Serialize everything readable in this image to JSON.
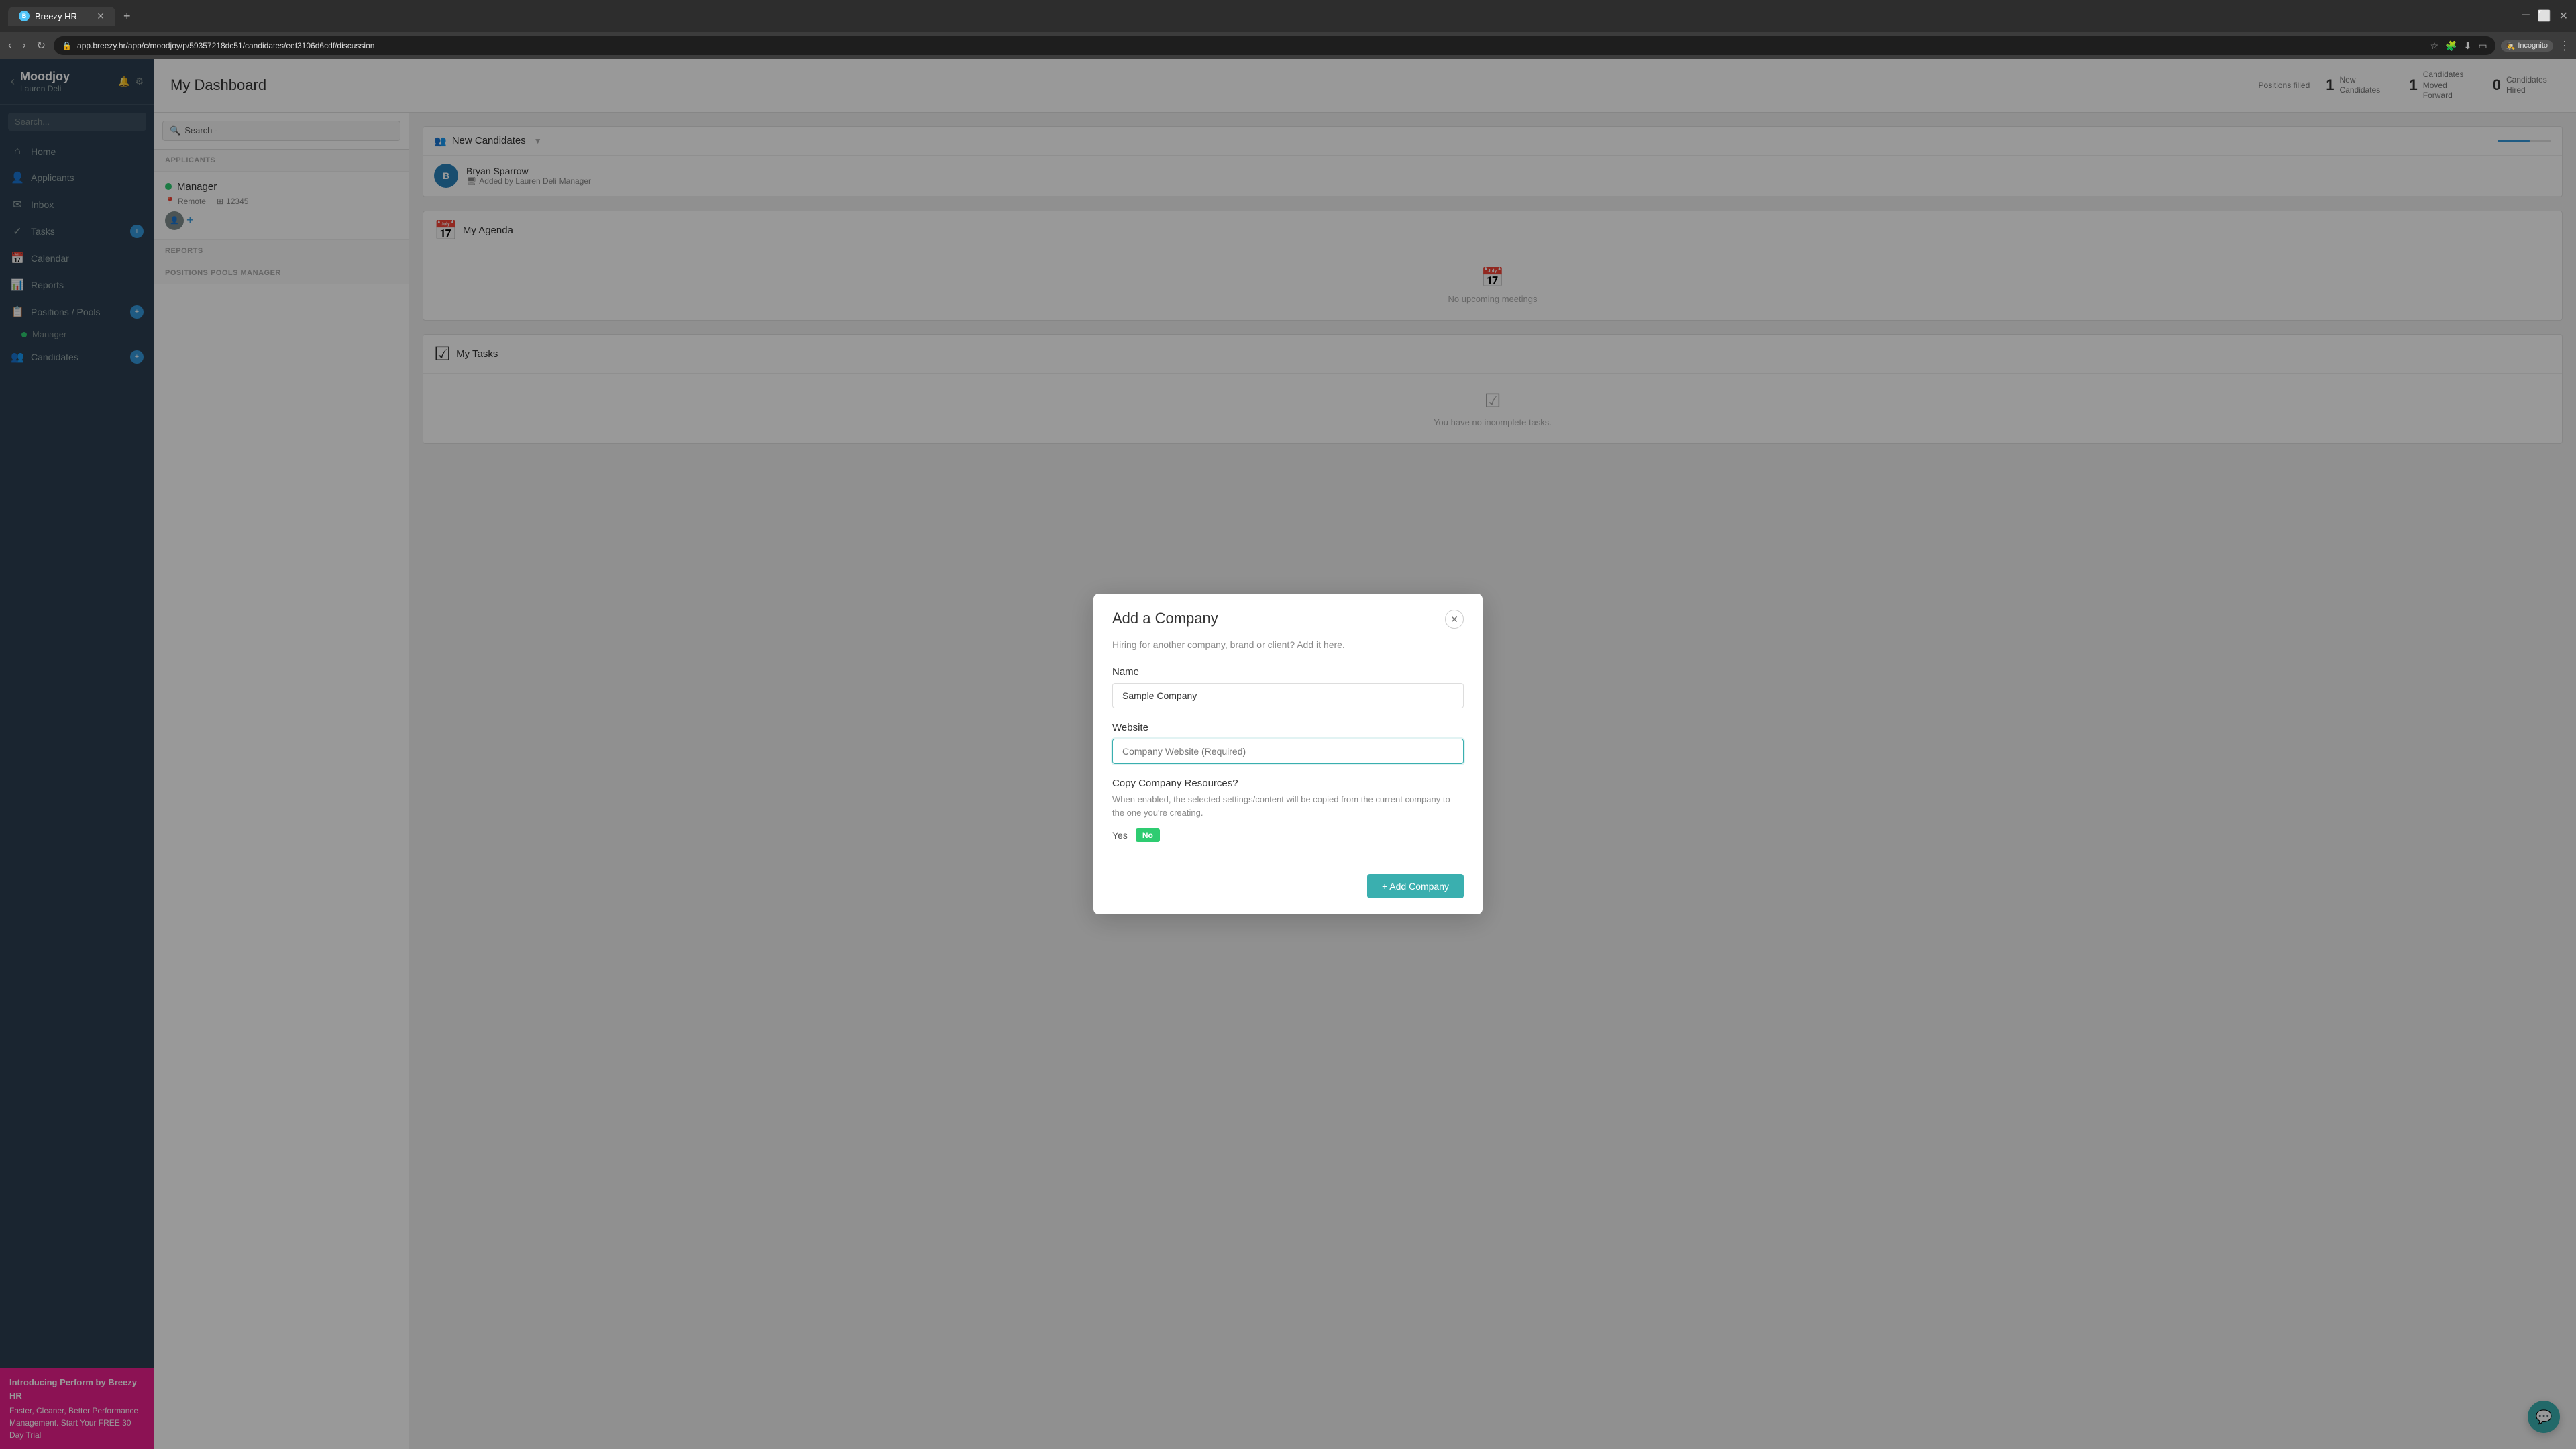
{
  "browser": {
    "tab_label": "Breezy HR",
    "url": "app.breezy.hr/app/c/moodjoy/p/59357218dc51/candidates/eef3106d6cdf/discussion",
    "incognito_label": "Incognito"
  },
  "sidebar": {
    "back_label": "‹",
    "brand_name": "Moodjoy",
    "brand_user": "Lauren Deli",
    "search_placeholder": "Search...",
    "nav_items": [
      {
        "id": "home",
        "label": "Home",
        "icon": "⌂"
      },
      {
        "id": "applicants",
        "label": "Applicants",
        "icon": "👤"
      },
      {
        "id": "inbox",
        "label": "Inbox",
        "icon": "✉"
      },
      {
        "id": "tasks",
        "label": "Tasks",
        "icon": "✓",
        "badge": "+"
      },
      {
        "id": "calendar",
        "label": "Calendar",
        "icon": "📅"
      },
      {
        "id": "reports",
        "label": "Reports",
        "icon": "📊"
      },
      {
        "id": "positions",
        "label": "Positions / Pools",
        "icon": "📋",
        "badge": "+"
      }
    ],
    "positions_sub": {
      "label": "Manager",
      "dot_color": "#2ecc71"
    },
    "candidates": {
      "label": "Candidates",
      "badge": "+"
    },
    "promo": {
      "title": "Introducing Perform by Breezy HR",
      "body": "Faster, Cleaner, Better Performance Management. Start Your FREE 30 Day Trial"
    }
  },
  "dashboard": {
    "title": "My Dashboard",
    "stats": [
      {
        "label": "Positions filled",
        "value": ""
      },
      {
        "label": "New Candidates",
        "value": "1"
      },
      {
        "label": "Candidates Moved Forward",
        "value": "1"
      },
      {
        "label": "Candidates Hired",
        "value": "0"
      }
    ]
  },
  "positions_panel": {
    "search_label": "Search  -",
    "section_applicants": "Applicants",
    "section_reports": "Reports",
    "section_pools_manager": "Positions Pools Manager",
    "position": {
      "name": "Manager",
      "location": "Remote",
      "id": "12345",
      "dot_color": "#2ecc71"
    }
  },
  "candidates_section": {
    "header_icon": "👥",
    "header_label": "New Candidates",
    "progress_value": 60,
    "candidate": {
      "initials": "B",
      "name": "Bryan Sparrow",
      "added_by": "Added by Lauren Deli",
      "role": "Manager",
      "avatar_bg": "#2980b9"
    }
  },
  "agenda_section": {
    "header_icon": "📅",
    "header_label": "My Agenda",
    "empty_label": "No upcoming meetings"
  },
  "tasks_section": {
    "header_icon": "☑",
    "header_label": "My Tasks",
    "empty_label": "You have no incomplete tasks."
  },
  "modal": {
    "title": "Add a Company",
    "subtitle": "Hiring for another company, brand or client? Add it here.",
    "name_label": "Name",
    "name_value": "Sample Company",
    "website_label": "Website",
    "website_placeholder": "Company Website (Required)",
    "copy_title": "Copy Company Resources?",
    "copy_desc": "When enabled, the selected settings/content will be copied from the current company to the one you're creating.",
    "toggle_yes": "Yes",
    "toggle_no": "No",
    "submit_label": "+ Add Company"
  }
}
